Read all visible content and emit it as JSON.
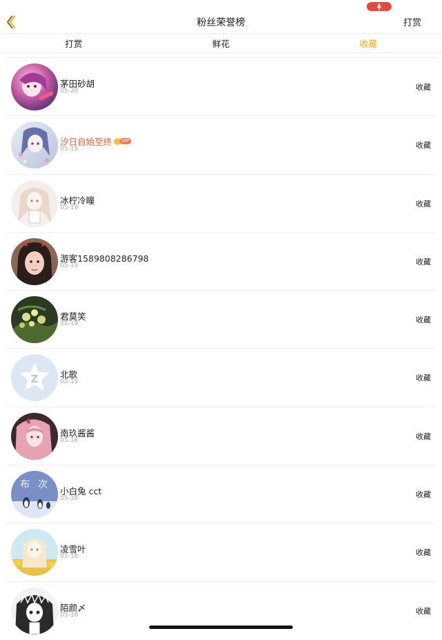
{
  "colors": {
    "accent": "#f0a51e",
    "vip_name": "#e25a3d",
    "date_gray": "#a8a8a8",
    "mic_red": "#e04a3f"
  },
  "status": {
    "mic_icon": "microphone-icon"
  },
  "nav": {
    "back_icon": "chevron-left-icon",
    "title": "粉丝荣誉榜",
    "right_action": "打赏"
  },
  "tabs": [
    {
      "label": "打赏",
      "active": false
    },
    {
      "label": "鲜花",
      "active": false
    },
    {
      "label": "收藏",
      "active": true
    }
  ],
  "vip_tag": "VIP",
  "rows": [
    {
      "name": "茅田砂胡",
      "date": "05-20",
      "action": "收藏",
      "vip": false,
      "avatar": "anime-avatar-pink"
    },
    {
      "name": "汐日自始至终",
      "date": "05-19",
      "action": "收藏",
      "vip": true,
      "avatar": "anime-avatar-snow"
    },
    {
      "name": "冰柠冷瞳",
      "date": "05-19",
      "action": "收藏",
      "vip": false,
      "avatar": "anime-avatar-blonde"
    },
    {
      "name": "游客1589808286798",
      "date": "05-19",
      "action": "收藏",
      "vip": false,
      "avatar": "photo-avatar-girl"
    },
    {
      "name": "君莫笑",
      "date": "05-19",
      "action": "收藏",
      "vip": false,
      "avatar": "flower-avatar"
    },
    {
      "name": "北歌",
      "date": "05-19",
      "action": "收藏",
      "vip": false,
      "avatar": "default-avatar"
    },
    {
      "name": "南玖酱酱",
      "date": "05-18",
      "action": "收藏",
      "vip": false,
      "avatar": "anime-avatar-pinkhair"
    },
    {
      "name": "小白兔 cct",
      "date": "05-18",
      "action": "收藏",
      "vip": false,
      "avatar": "penguin-avatar"
    },
    {
      "name": "凌雪叶",
      "date": "05-18",
      "action": "收藏",
      "vip": false,
      "avatar": "anime-avatar-sunflower"
    },
    {
      "name": "陌颜〆",
      "date": "05-18",
      "action": "收藏",
      "vip": false,
      "avatar": "anime-avatar-monochrome"
    }
  ]
}
